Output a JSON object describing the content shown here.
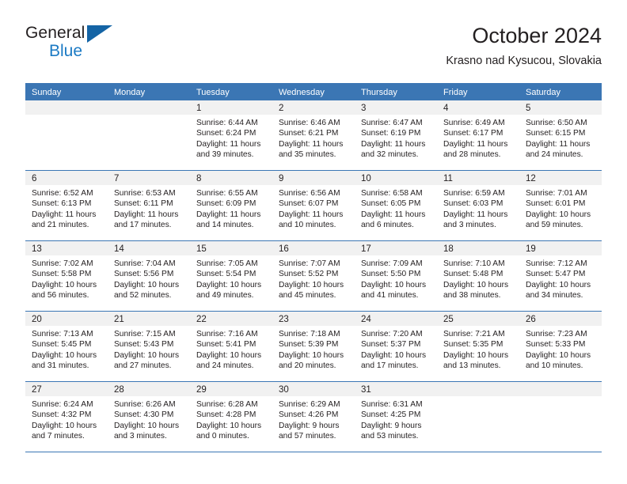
{
  "brand": {
    "name_top": "General",
    "name_bottom": "Blue",
    "triangle_color": "#1464a5",
    "blue_text_color": "#1b7ac4"
  },
  "header": {
    "title": "October 2024",
    "subtitle": "Krasno nad Kysucou, Slovakia"
  },
  "theme": {
    "header_blue": "#3b76b4",
    "day_band_gray": "#f1f1f1",
    "text": "#231f20"
  },
  "weekdays": [
    "Sunday",
    "Monday",
    "Tuesday",
    "Wednesday",
    "Thursday",
    "Friday",
    "Saturday"
  ],
  "weeks": [
    [
      {
        "day": "",
        "lines": []
      },
      {
        "day": "",
        "lines": []
      },
      {
        "day": "1",
        "lines": [
          "Sunrise: 6:44 AM",
          "Sunset: 6:24 PM",
          "Daylight: 11 hours",
          "and 39 minutes."
        ]
      },
      {
        "day": "2",
        "lines": [
          "Sunrise: 6:46 AM",
          "Sunset: 6:21 PM",
          "Daylight: 11 hours",
          "and 35 minutes."
        ]
      },
      {
        "day": "3",
        "lines": [
          "Sunrise: 6:47 AM",
          "Sunset: 6:19 PM",
          "Daylight: 11 hours",
          "and 32 minutes."
        ]
      },
      {
        "day": "4",
        "lines": [
          "Sunrise: 6:49 AM",
          "Sunset: 6:17 PM",
          "Daylight: 11 hours",
          "and 28 minutes."
        ]
      },
      {
        "day": "5",
        "lines": [
          "Sunrise: 6:50 AM",
          "Sunset: 6:15 PM",
          "Daylight: 11 hours",
          "and 24 minutes."
        ]
      }
    ],
    [
      {
        "day": "6",
        "lines": [
          "Sunrise: 6:52 AM",
          "Sunset: 6:13 PM",
          "Daylight: 11 hours",
          "and 21 minutes."
        ]
      },
      {
        "day": "7",
        "lines": [
          "Sunrise: 6:53 AM",
          "Sunset: 6:11 PM",
          "Daylight: 11 hours",
          "and 17 minutes."
        ]
      },
      {
        "day": "8",
        "lines": [
          "Sunrise: 6:55 AM",
          "Sunset: 6:09 PM",
          "Daylight: 11 hours",
          "and 14 minutes."
        ]
      },
      {
        "day": "9",
        "lines": [
          "Sunrise: 6:56 AM",
          "Sunset: 6:07 PM",
          "Daylight: 11 hours",
          "and 10 minutes."
        ]
      },
      {
        "day": "10",
        "lines": [
          "Sunrise: 6:58 AM",
          "Sunset: 6:05 PM",
          "Daylight: 11 hours",
          "and 6 minutes."
        ]
      },
      {
        "day": "11",
        "lines": [
          "Sunrise: 6:59 AM",
          "Sunset: 6:03 PM",
          "Daylight: 11 hours",
          "and 3 minutes."
        ]
      },
      {
        "day": "12",
        "lines": [
          "Sunrise: 7:01 AM",
          "Sunset: 6:01 PM",
          "Daylight: 10 hours",
          "and 59 minutes."
        ]
      }
    ],
    [
      {
        "day": "13",
        "lines": [
          "Sunrise: 7:02 AM",
          "Sunset: 5:58 PM",
          "Daylight: 10 hours",
          "and 56 minutes."
        ]
      },
      {
        "day": "14",
        "lines": [
          "Sunrise: 7:04 AM",
          "Sunset: 5:56 PM",
          "Daylight: 10 hours",
          "and 52 minutes."
        ]
      },
      {
        "day": "15",
        "lines": [
          "Sunrise: 7:05 AM",
          "Sunset: 5:54 PM",
          "Daylight: 10 hours",
          "and 49 minutes."
        ]
      },
      {
        "day": "16",
        "lines": [
          "Sunrise: 7:07 AM",
          "Sunset: 5:52 PM",
          "Daylight: 10 hours",
          "and 45 minutes."
        ]
      },
      {
        "day": "17",
        "lines": [
          "Sunrise: 7:09 AM",
          "Sunset: 5:50 PM",
          "Daylight: 10 hours",
          "and 41 minutes."
        ]
      },
      {
        "day": "18",
        "lines": [
          "Sunrise: 7:10 AM",
          "Sunset: 5:48 PM",
          "Daylight: 10 hours",
          "and 38 minutes."
        ]
      },
      {
        "day": "19",
        "lines": [
          "Sunrise: 7:12 AM",
          "Sunset: 5:47 PM",
          "Daylight: 10 hours",
          "and 34 minutes."
        ]
      }
    ],
    [
      {
        "day": "20",
        "lines": [
          "Sunrise: 7:13 AM",
          "Sunset: 5:45 PM",
          "Daylight: 10 hours",
          "and 31 minutes."
        ]
      },
      {
        "day": "21",
        "lines": [
          "Sunrise: 7:15 AM",
          "Sunset: 5:43 PM",
          "Daylight: 10 hours",
          "and 27 minutes."
        ]
      },
      {
        "day": "22",
        "lines": [
          "Sunrise: 7:16 AM",
          "Sunset: 5:41 PM",
          "Daylight: 10 hours",
          "and 24 minutes."
        ]
      },
      {
        "day": "23",
        "lines": [
          "Sunrise: 7:18 AM",
          "Sunset: 5:39 PM",
          "Daylight: 10 hours",
          "and 20 minutes."
        ]
      },
      {
        "day": "24",
        "lines": [
          "Sunrise: 7:20 AM",
          "Sunset: 5:37 PM",
          "Daylight: 10 hours",
          "and 17 minutes."
        ]
      },
      {
        "day": "25",
        "lines": [
          "Sunrise: 7:21 AM",
          "Sunset: 5:35 PM",
          "Daylight: 10 hours",
          "and 13 minutes."
        ]
      },
      {
        "day": "26",
        "lines": [
          "Sunrise: 7:23 AM",
          "Sunset: 5:33 PM",
          "Daylight: 10 hours",
          "and 10 minutes."
        ]
      }
    ],
    [
      {
        "day": "27",
        "lines": [
          "Sunrise: 6:24 AM",
          "Sunset: 4:32 PM",
          "Daylight: 10 hours",
          "and 7 minutes."
        ]
      },
      {
        "day": "28",
        "lines": [
          "Sunrise: 6:26 AM",
          "Sunset: 4:30 PM",
          "Daylight: 10 hours",
          "and 3 minutes."
        ]
      },
      {
        "day": "29",
        "lines": [
          "Sunrise: 6:28 AM",
          "Sunset: 4:28 PM",
          "Daylight: 10 hours",
          "and 0 minutes."
        ]
      },
      {
        "day": "30",
        "lines": [
          "Sunrise: 6:29 AM",
          "Sunset: 4:26 PM",
          "Daylight: 9 hours",
          "and 57 minutes."
        ]
      },
      {
        "day": "31",
        "lines": [
          "Sunrise: 6:31 AM",
          "Sunset: 4:25 PM",
          "Daylight: 9 hours",
          "and 53 minutes."
        ]
      },
      {
        "day": "",
        "lines": []
      },
      {
        "day": "",
        "lines": []
      }
    ]
  ]
}
